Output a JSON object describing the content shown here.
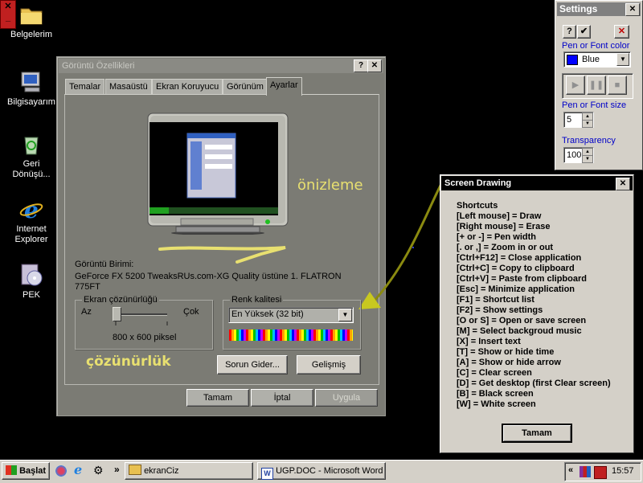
{
  "desktop": {
    "icons": [
      {
        "label": "Belgelerim",
        "icon": "folder-icon"
      },
      {
        "label": "Bilgisayarım",
        "icon": "computer-icon"
      },
      {
        "label": "Geri Dönüşü...",
        "icon": "recycle-bin-icon"
      },
      {
        "label": "Internet Explorer",
        "icon": "internet-explorer-icon"
      },
      {
        "label": "PEK",
        "icon": "cd-icon"
      }
    ]
  },
  "display_window": {
    "title": "Görüntü Özellikleri",
    "tabs": [
      "Temalar",
      "Masaüstü",
      "Ekran Koruyucu",
      "Görünüm",
      "Ayarlar"
    ],
    "active_tab": "Ayarlar",
    "annotation_preview": "önizleme",
    "annotation_resolution": "çözünürlük",
    "display_label": "Görüntü Birimi:",
    "display_value": "GeForce FX 5200  TweaksRUs.com-XG Quality üstüne 1. FLATRON 775FT",
    "resolution_group": "Ekran çözünürlüğü",
    "res_low": "Az",
    "res_high": "Çok",
    "res_value": "800 x 600 piksel",
    "color_group": "Renk kalitesi",
    "color_value": "En Yüksek (32 bit)",
    "troubleshoot_btn": "Sorun Gider...",
    "advanced_btn": "Gelişmiş",
    "ok_btn": "Tamam",
    "cancel_btn": "İptal",
    "apply_btn": "Uygula"
  },
  "settings_window": {
    "title": "Settings",
    "pen_color_label": "Pen or Font color",
    "pen_color_value": "Blue",
    "pen_color_hex": "#0000ff",
    "pen_size_label": "Pen or Font size",
    "pen_size_value": "5",
    "transparency_label": "Transparency",
    "transparency_value": "100"
  },
  "drawing_window": {
    "title": "Screen Drawing",
    "heading": "Shortcuts",
    "shortcuts": [
      "[Left mouse] = Draw",
      "[Right mouse] = Erase",
      "[+ or -] = Pen width",
      "[. or ,] = Zoom in or out",
      "[Ctrl+F12] = Close application",
      "[Ctrl+C] = Copy to clipboard",
      "[Ctrl+V] = Paste from clipboard",
      "[Esc] = Minimize application",
      "[F1] = Shortcut list",
      "[F2] = Show settings",
      "[O or S] = Open or save screen",
      "[M] = Select backgroud music",
      "[X] = Insert text",
      "[T] = Show or hide time",
      "[A] = Show or hide arrow",
      "[C] = Clear screen",
      "[D] = Get desktop (first Clear screen)",
      "[B] = Black screen",
      "[W] = White screen"
    ],
    "ok_btn": "Tamam"
  },
  "taskbar": {
    "start_label": "Başlat",
    "tasks": [
      {
        "label": "ekranCiz",
        "icon": "folder-icon"
      },
      {
        "label": "UGP.DOC - Microsoft Word",
        "icon": "word-icon"
      }
    ],
    "clock": "15:57"
  },
  "colors": {
    "annotation_yellow": "#e8e070",
    "arrow_olive": "#8a8a10",
    "title_blue_label": "#0000c8"
  }
}
